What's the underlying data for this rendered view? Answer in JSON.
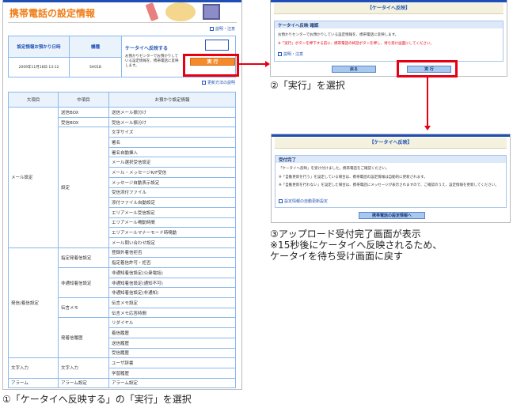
{
  "step1": {
    "page_title": "携帯電話の設定情報",
    "help_link": "説明・注意",
    "info_table": {
      "headers": [
        "設定情報お預かり日時",
        "機種"
      ],
      "date": "2009年11月18日 13:12",
      "model": "SH01B",
      "reflect_title": "ケータイへ反映する",
      "reflect_desc": "お預かりセンターでお預かりしている設定情報を、携帯電話に反映します。",
      "exec_button": "実 行"
    },
    "update_link": "更新方法の説明",
    "main_table": {
      "headers": [
        "大項目",
        "中項目",
        "お預かり設定情報"
      ],
      "groups": [
        {
          "major": "メール設定",
          "subs": [
            {
              "mid": "送信BOX",
              "items": [
                "送信メール振分け"
              ]
            },
            {
              "mid": "受信BOX",
              "items": [
                "受信メール振分け"
              ]
            },
            {
              "mid": "設定",
              "items": [
                "文字サイズ",
                "署名",
                "署名自動挿入",
                "メール選択受信設定",
                "メール・メッセージR/F受信",
                "メッセージ自動表示設定",
                "受信添付ファイル",
                "添付ファイル自動設定",
                "エリアメール受信設定",
                "エリアメール鳴動時間",
                "エリアメールマナーモード時鳴動",
                "メール問い合わせ設定"
              ]
            }
          ]
        },
        {
          "major": "発信/着信設定",
          "subs": [
            {
              "mid": "指定発着信設定",
              "items": [
                "登録外着信拒否",
                "指定着信許可・拒否"
              ]
            },
            {
              "mid": "非通知着信設定",
              "items": [
                "非通知着信設定(公衆電話)",
                "非通知着信設定(通知不可)",
                "非通知着信設定(非通知)"
              ]
            },
            {
              "mid": "伝言メモ",
              "items": [
                "伝言メモ設定",
                "伝言メモ応答時間"
              ]
            },
            {
              "mid": "発着信履歴",
              "items": [
                "リダイヤル",
                "着信履歴",
                "送信履歴",
                "受信履歴"
              ]
            }
          ]
        },
        {
          "major": "文字入力",
          "subs": [
            {
              "mid": "文字入力",
              "items": [
                "ユーザ辞書",
                "学習履歴"
              ]
            }
          ]
        },
        {
          "major": "アラーム",
          "subs": [
            {
              "mid": "アラーム設定",
              "items": [
                "アラーム設定"
              ]
            }
          ]
        }
      ]
    },
    "caption": "①「ケータイへ反映する」の「実行」を選択"
  },
  "step2": {
    "header": "【ケータイへ反映】",
    "box_title": "ケータイへ反映 確認",
    "text": "お預かりセンターでお預かりしている設定情報を、携帯電話に反映します。",
    "warning": "※「実行」ボタンを押下する前に、携帯電話の終話ボタンを押し、待ち受け画面にしてください。",
    "help_link": "説明・注意",
    "back_button": "戻る",
    "exec_button": "実 行",
    "caption": "②「実行」を選択"
  },
  "step3": {
    "header": "【ケータイへ反映】",
    "box_title": "受付完了",
    "lines": [
      "「ケータイへ反映」を受け付けました。携帯電話をご確認ください。",
      "※「自動更新を行う」を設定している場合は、携帯電話の設定情報は自動的に更新されます。",
      "※「自動更新を行わない」を設定した場合は、携帯電話にメッセージが表示されますので、ご確認のうえ、設定情報を更新してください。"
    ],
    "link": "設定情報の自動更新設定",
    "button": "携帯電話の設定情報へ",
    "caption": [
      "③アップロード受付完了画面が表示",
      "※15秒後にケータイへ反映されるため、",
      "ケータイを待ち受け画面に戻す"
    ]
  },
  "colors": {
    "accent_orange": "#f07d16",
    "highlight_red": "#e50012",
    "link_blue": "#2254b4"
  }
}
